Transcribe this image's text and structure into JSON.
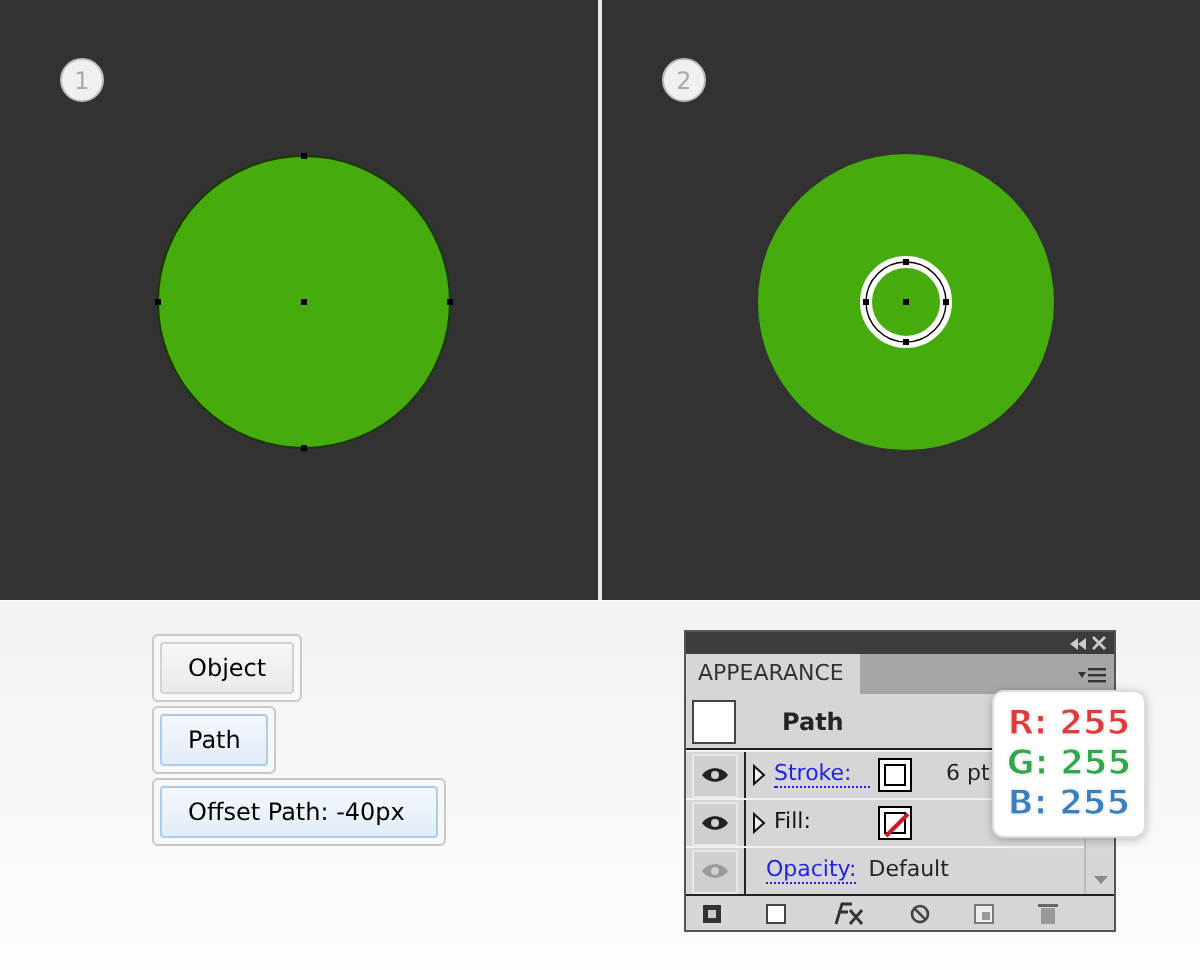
{
  "steps": [
    {
      "number": "1",
      "kind": "original"
    },
    {
      "number": "2",
      "kind": "offset"
    }
  ],
  "menu_path": [
    {
      "label": "Object",
      "selected": false
    },
    {
      "label": "Path",
      "selected": true
    },
    {
      "label": "Offset Path: -40px",
      "selected": true
    }
  ],
  "appearance_panel": {
    "title": "APPEARANCE",
    "header": "Path",
    "rows": [
      {
        "kind": "stroke",
        "label": "Stroke:",
        "value": "6 pt",
        "visible": true
      },
      {
        "kind": "fill",
        "label": "Fill:",
        "visible": true
      },
      {
        "kind": "opacity",
        "label": "Opacity:",
        "value": "Default",
        "visible": false
      }
    ]
  },
  "color_callout": [
    {
      "text": "R: 255",
      "color": "#e03a3a"
    },
    {
      "text": "G: 255",
      "color": "#2ea84a"
    },
    {
      "text": "B: 255",
      "color": "#3a7fc0"
    }
  ]
}
